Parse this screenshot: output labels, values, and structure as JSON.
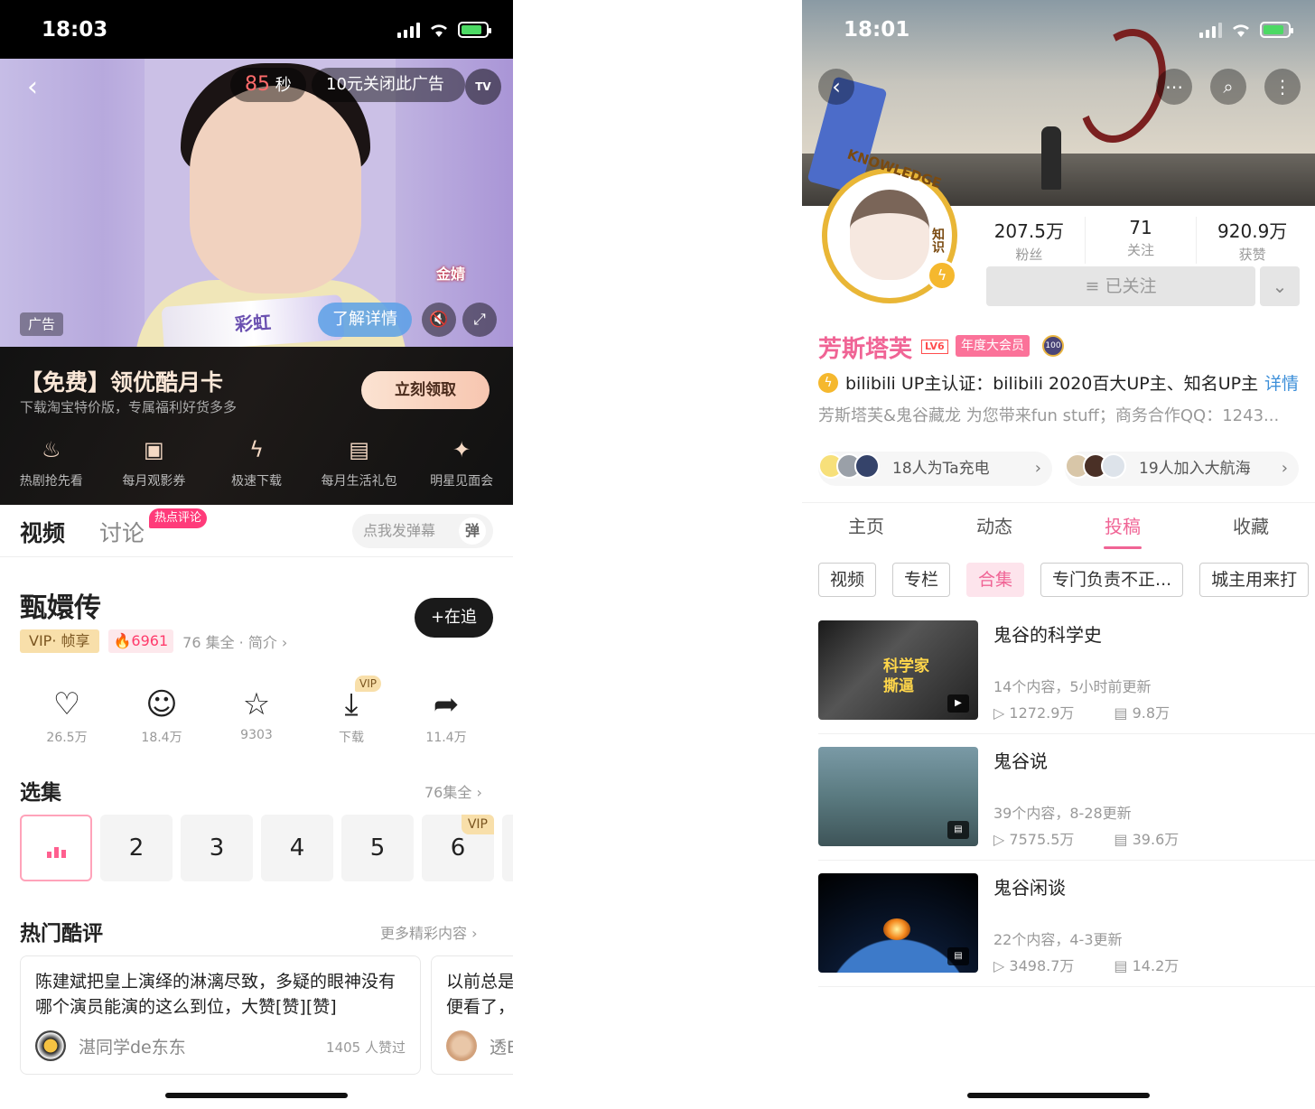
{
  "left": {
    "status": {
      "time": "18:03"
    },
    "ad": {
      "countdown_value": "85",
      "countdown_unit": "秒",
      "close_ad": "10元关闭此广告",
      "tv_badge": "TV",
      "ad_label": "广告",
      "learn_more": "了解详情",
      "overlay_text": "金婧",
      "product_text": "彩虹"
    },
    "vip_banner": {
      "title": "【免费】领优酷月卡",
      "subtitle": "下载淘宝特价版，专属福利好货多多",
      "claim_button": "立刻领取",
      "perks": [
        {
          "icon": "flame-icon",
          "label": "热剧抢先看"
        },
        {
          "icon": "ticket-icon",
          "label": "每月观影券"
        },
        {
          "icon": "lightning-icon",
          "label": "极速下载"
        },
        {
          "icon": "gift-icon",
          "label": "每月生活礼包"
        },
        {
          "icon": "sparkle-icon",
          "label": "明星见面会"
        }
      ]
    },
    "tabs": {
      "video": "视频",
      "discussion": "讨论",
      "hot_tag": "热点评论"
    },
    "danmu": {
      "placeholder": "点我发弹幕",
      "icon_label": "弹"
    },
    "show": {
      "title": "甄嬛传",
      "follow_button": "+在追",
      "vip_tag": "VIP· 帧享",
      "heat": "6961",
      "info": "76 集全 · 简介 ›"
    },
    "actions": [
      {
        "icon": "heart-icon",
        "glyph": "♡",
        "label": "26.5万"
      },
      {
        "icon": "comment-icon",
        "glyph": "☺",
        "label": "18.4万"
      },
      {
        "icon": "star-icon",
        "glyph": "☆",
        "label": "9303"
      },
      {
        "icon": "download-icon",
        "glyph": "⤓",
        "label": "下载",
        "badge": "VIP"
      },
      {
        "icon": "share-icon",
        "glyph": "➦",
        "label": "11.4万"
      }
    ],
    "episodes": {
      "title": "选集",
      "more": "76集全 ›",
      "items": [
        "2",
        "3",
        "4",
        "5",
        "6"
      ],
      "vip_badge": "VIP"
    },
    "reviews": {
      "title": "热门酷评",
      "more": "更多精彩内容 ›",
      "items": [
        {
          "text": "陈建斌把皇上演绎的淋漓尽致，多疑的眼神没有哪个演员能演的这么到位，大赞[赞][赞]",
          "user": "湛同学de东东",
          "likes": "1405 人赞过"
        },
        {
          "text": "以前总是便看了，",
          "user": "透E",
          "likes": ""
        }
      ]
    }
  },
  "right": {
    "status": {
      "time": "18:01"
    },
    "avatar_ring_text": "KNOWLEDGE",
    "avatar_side_text": "知识",
    "stats": [
      {
        "value": "207.5万",
        "label": "粉丝"
      },
      {
        "value": "71",
        "label": "关注"
      },
      {
        "value": "920.9万",
        "label": "获赞"
      }
    ],
    "followed_button": "≡ 已关注",
    "profile": {
      "name": "芳斯塔芙",
      "level": "LV6",
      "vip": "年度大会员",
      "verify": "bilibili  UP主认证：bilibili  2020百大UP主、知名UP主",
      "verify_detail": "详情",
      "bio": "芳斯塔芙&鬼谷藏龙  为您带来fun  stuff；商务合作QQ：1243..."
    },
    "support": [
      {
        "text": "18人为Ta充电"
      },
      {
        "text": "19人加入大航海"
      }
    ],
    "tabs": [
      "主页",
      "动态",
      "投稿",
      "收藏"
    ],
    "active_tab": "投稿",
    "chips": [
      "视频",
      "专栏",
      "合集",
      "专门负责不正...",
      "城主用来打"
    ],
    "collections": [
      {
        "title": "鬼谷的科学史",
        "info": "14个内容，5小时前更新",
        "views": "1272.9万",
        "danmaku": "9.8万",
        "thumb_text": "科学家撕逼"
      },
      {
        "title": "鬼谷说",
        "info": "39个内容，8-28更新",
        "views": "7575.5万",
        "danmaku": "39.6万",
        "thumb_text": ""
      },
      {
        "title": "鬼谷闲谈",
        "info": "22个内容，4-3更新",
        "views": "3498.7万",
        "danmaku": "14.2万",
        "thumb_text": ""
      }
    ]
  },
  "colors": {
    "bili_pink": "#f06495",
    "youku_pink": "#ff3b7a",
    "vip_gold": "#f8dfaa",
    "link_blue": "#3d8fd9"
  }
}
